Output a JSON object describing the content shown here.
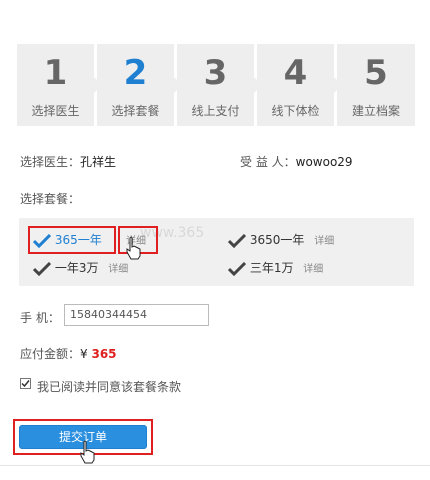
{
  "steps": [
    {
      "num": "1",
      "label": "选择医生"
    },
    {
      "num": "2",
      "label": "选择套餐"
    },
    {
      "num": "3",
      "label": "线上支付"
    },
    {
      "num": "4",
      "label": "线下体检"
    },
    {
      "num": "5",
      "label": "建立档案"
    }
  ],
  "doctor": {
    "label": "选择医生：",
    "value": "孔祥生"
  },
  "beneficiary": {
    "label": "受 益 人：",
    "value": "wowoo29"
  },
  "package_label": "选择套餐：",
  "packages": [
    {
      "name": "365一年",
      "detail": "详细",
      "selected": true
    },
    {
      "name": "3650一年",
      "detail": "详细"
    },
    {
      "name": "一年3万",
      "detail": "详细"
    },
    {
      "name": "三年1万",
      "detail": "详细"
    }
  ],
  "watermark": "www.365",
  "phone": {
    "label": "手  机：",
    "value": "15840344454"
  },
  "amount": {
    "label": "应付金额：",
    "currency": "¥",
    "value": "365"
  },
  "agreement": {
    "label": "我已阅读并同意该套餐条款",
    "checked": true
  },
  "submit_label": "提交订单",
  "colors": {
    "accent": "#1f7fd1",
    "highlight": "#e02020",
    "button": "#2b8fe0"
  }
}
